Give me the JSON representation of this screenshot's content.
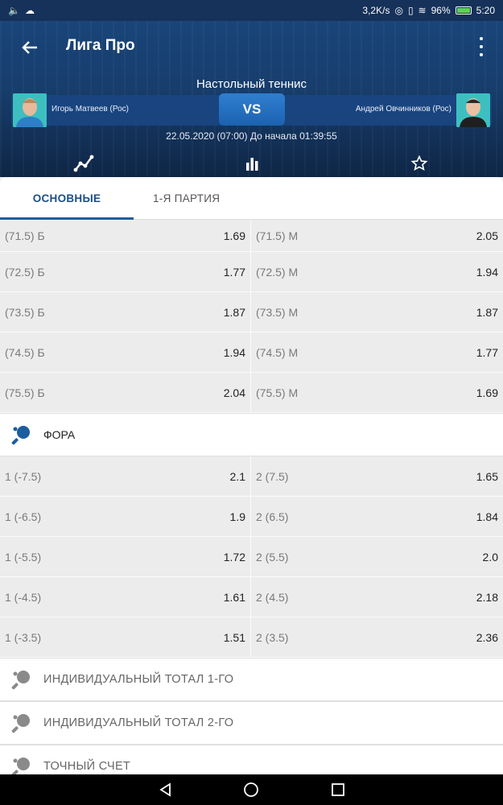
{
  "status": {
    "speed": "3,2K/s",
    "battery": "96%",
    "time": "5:20"
  },
  "header": {
    "title": "Лига Про",
    "sport": "Настольный теннис",
    "player1": "Игорь Матвеев (Рос)",
    "player2": "Андрей Овчинников (Рос)",
    "vs": "VS",
    "datetime": "22.05.2020 (07:00)  До начала 01:39:55"
  },
  "tabs": {
    "main": "ОСНОВНЫЕ",
    "first_set": "1-Я ПАРТИЯ"
  },
  "totals": [
    {
      "left_label": "(71.5) Б",
      "left_val": "1.69",
      "right_label": "(71.5) М",
      "right_val": "2.05"
    },
    {
      "left_label": "(72.5) Б",
      "left_val": "1.77",
      "right_label": "(72.5) М",
      "right_val": "1.94"
    },
    {
      "left_label": "(73.5) Б",
      "left_val": "1.87",
      "right_label": "(73.5) М",
      "right_val": "1.87"
    },
    {
      "left_label": "(74.5) Б",
      "left_val": "1.94",
      "right_label": "(74.5) М",
      "right_val": "1.77"
    },
    {
      "left_label": "(75.5) Б",
      "left_val": "2.04",
      "right_label": "(75.5) М",
      "right_val": "1.69"
    }
  ],
  "handicap": {
    "title": "ФОРА",
    "rows": [
      {
        "left_label": "1 (-7.5)",
        "left_val": "2.1",
        "right_label": "2 (7.5)",
        "right_val": "1.65"
      },
      {
        "left_label": "1 (-6.5)",
        "left_val": "1.9",
        "right_label": "2 (6.5)",
        "right_val": "1.84"
      },
      {
        "left_label": "1 (-5.5)",
        "left_val": "1.72",
        "right_label": "2 (5.5)",
        "right_val": "2.0"
      },
      {
        "left_label": "1 (-4.5)",
        "left_val": "1.61",
        "right_label": "2 (4.5)",
        "right_val": "2.18"
      },
      {
        "left_label": "1 (-3.5)",
        "left_val": "1.51",
        "right_label": "2 (3.5)",
        "right_val": "2.36"
      }
    ]
  },
  "sections": {
    "ind_total_1": "ИНДИВИДУАЛЬНЫЙ ТОТАЛ 1-ГО",
    "ind_total_2": "ИНДИВИДУАЛЬНЫЙ ТОТАЛ 2-ГО",
    "exact_score": "ТОЧНЫЙ СЧЕТ"
  },
  "colors": {
    "header_bg": "#173d6b",
    "accent": "#1d5d9e",
    "row_bg": "#ececec"
  }
}
